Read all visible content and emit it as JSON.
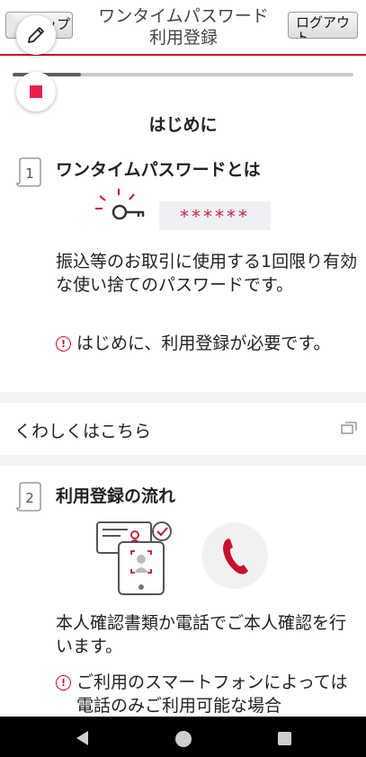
{
  "header": {
    "back_label": "トップ",
    "title_line1": "ワンタイムパスワード",
    "title_line2": "利用登録",
    "logout_label": "ログアウト"
  },
  "overlay": {
    "edit_icon": "pencil-icon",
    "stop_icon": "stop-icon"
  },
  "progress": {
    "fraction": 0.2
  },
  "intro": {
    "heading": "はじめに"
  },
  "section1": {
    "step": "1",
    "title": "ワンタイムパスワードとは",
    "otp_mask": "******",
    "description": "振込等のお取引に使用する1回限り有効な使い捨てのパスワードです。",
    "note": "はじめに、利用登録が必要です。"
  },
  "details_link": {
    "label": "くわしくはこちら",
    "icon": "external-window-icon"
  },
  "section2": {
    "step": "2",
    "title": "利用登録の流れ",
    "description": "本人確認書類か電話でご本人確認を行います。",
    "note": "ご利用のスマートフォンによっては電話のみご利用可能な場合"
  },
  "colors": {
    "accent": "#c8102e",
    "fab_stop": "#e91e4f"
  }
}
